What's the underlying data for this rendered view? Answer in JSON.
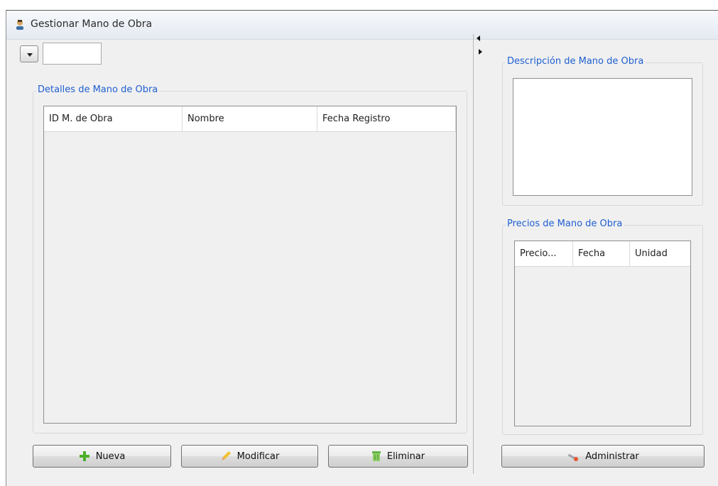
{
  "window": {
    "title": "Gestionar Mano de Obra"
  },
  "detalles": {
    "group_title": "Detalles de Mano de Obra",
    "columns": [
      "ID M. de Obra",
      "Nombre",
      "Fecha Registro"
    ]
  },
  "descripcion": {
    "group_title": "Descripción de Mano de Obra",
    "text": ""
  },
  "precios": {
    "group_title": "Precios de Mano de Obra",
    "columns": [
      "Precio...",
      "Fecha",
      "Unidad"
    ]
  },
  "buttons": {
    "nueva": "Nueva",
    "modificar": "Modificar",
    "eliminar": "Eliminar",
    "administrar": "Administrar"
  },
  "selector": {
    "value": ""
  },
  "icons": {
    "title": "person-icon",
    "nueva": "plus-icon",
    "modificar": "pencil-icon",
    "eliminar": "trash-icon",
    "administrar": "wrench-icon"
  },
  "colors": {
    "group_title": "#1f5fd1"
  }
}
